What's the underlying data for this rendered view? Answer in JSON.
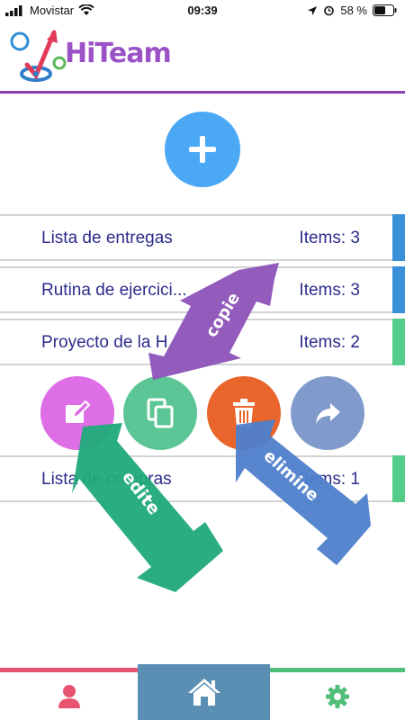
{
  "status": {
    "carrier": "Movistar",
    "time": "09:39",
    "battery": "58 %"
  },
  "header": {
    "app_name": "HiTeam"
  },
  "lists": [
    {
      "name": "Lista de entregas",
      "items": "Items: 3",
      "color": "#3a8fd9"
    },
    {
      "name": "Rutina de ejercici...",
      "items": "Items: 3",
      "color": "#3a8fd9"
    },
    {
      "name": "Proyecto de la H",
      "items": "Items: 2",
      "color": "#55cc8a"
    },
    {
      "name": "Lista de compras",
      "items": "Items: 1",
      "color": "#55cc8a"
    }
  ],
  "actions": [
    {
      "name": "edit",
      "color": "#dd6ee6"
    },
    {
      "name": "copy",
      "color": "#5cc596"
    },
    {
      "name": "delete",
      "color": "#e9652c"
    },
    {
      "name": "share",
      "color": "#7f9acb"
    }
  ],
  "annotations": {
    "copy": "copie",
    "edit": "edite",
    "delete": "elimine"
  },
  "colors": {
    "accent": "#8a3fae",
    "add_button": "#4aa8f5",
    "nav_profile": "#e8546f",
    "nav_home": "#5a8fb3",
    "nav_settings": "#4fbf7a"
  },
  "nav": [
    "profile",
    "home",
    "settings"
  ]
}
